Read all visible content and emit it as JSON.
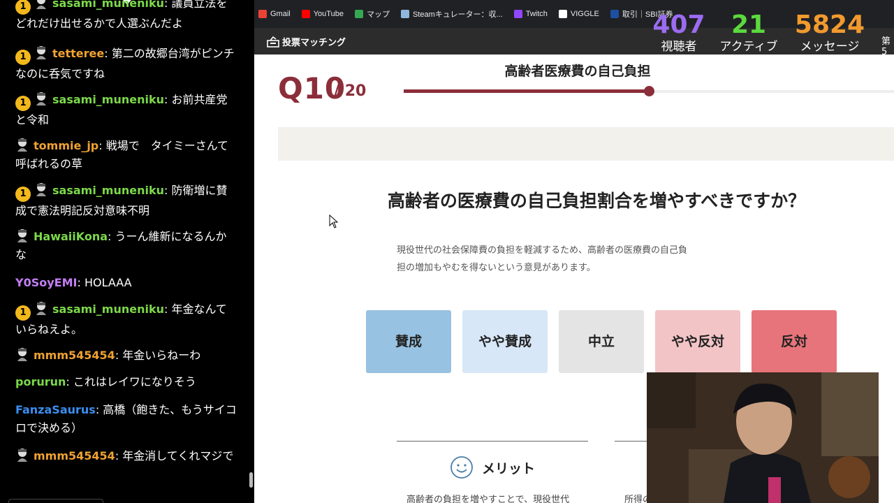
{
  "chat": {
    "messages": [
      {
        "badge": "1",
        "user": "sasami_muneniku",
        "color": "green",
        "text": ": 議員立法を どれだけ出せるかで人選ぶんだよ"
      },
      {
        "badge": "1",
        "user": "tetteree",
        "color": "orange",
        "text": ": 第二の故郷台湾がピンチなのに呑気ですね"
      },
      {
        "badge": "1",
        "user": "sasami_muneniku",
        "color": "green",
        "text": ": お前共産党と令和"
      },
      {
        "badge": "",
        "user": "tommie_jp",
        "color": "orange",
        "text": ": 戦場で　タイミーさんて呼ばれるの草"
      },
      {
        "badge": "1",
        "user": "sasami_muneniku",
        "color": "green",
        "text": ": 防衛増に賛成で憲法明記反対意味不明"
      },
      {
        "badge": "",
        "user": "HawaiiKona",
        "color": "green",
        "text": ": うーん維新になるんかな"
      },
      {
        "badge": "",
        "user": "Y0SoyEMI",
        "color": "purple",
        "text": ": HOLAAA"
      },
      {
        "badge": "1",
        "user": "sasami_muneniku",
        "color": "green",
        "text": ": 年金なんていらねえよ。"
      },
      {
        "badge": "",
        "user": "mmm545454",
        "color": "orange",
        "text": ": 年金いらねーわ"
      },
      {
        "badge": "",
        "user": "porurun",
        "color": "green",
        "text": ": これはレイワになりそう"
      },
      {
        "badge": "",
        "user": "FanzaSaurus",
        "color": "blue",
        "text": ": 高橋（飽きた、もうサイコロで決める）"
      },
      {
        "badge": "",
        "user": "mmm545454",
        "color": "orange",
        "text": ": 年金消してくれマジで"
      }
    ]
  },
  "bookmarks": [
    {
      "label": "Gmail",
      "icon": "gmail-icon",
      "color": "#ea4335"
    },
    {
      "label": "YouTube",
      "icon": "youtube-icon",
      "color": "#ff0000"
    },
    {
      "label": "マップ",
      "icon": "maps-icon",
      "color": "#34a853"
    },
    {
      "label": "Steamキュレーター：収...",
      "icon": "steam-icon",
      "color": "#8fb8de"
    },
    {
      "label": "Twitch",
      "icon": "twitch-icon",
      "color": "#9146ff"
    },
    {
      "label": "VIGGLE",
      "icon": "viggle-icon",
      "color": "#ffffff"
    },
    {
      "label": "取引｜SBI証券",
      "icon": "sbi-icon",
      "color": "#1d4fa3"
    }
  ],
  "site": {
    "logo_text": "投票マッチング"
  },
  "stats": {
    "viewers": {
      "value": "407",
      "label": "視聴者"
    },
    "active": {
      "value": "21",
      "label": "アクティブ"
    },
    "messages": {
      "value": "5824",
      "label": "メッセージ"
    },
    "extra": "第5"
  },
  "quiz": {
    "question_number": "Q10",
    "total": "/ 20",
    "progress": 0.5,
    "topic": "高齢者医療費の自己負担",
    "question": "高齢者の医療費の自己負担割合を増やすべきですか？",
    "description": "現役世代の社会保障費の負担を軽減するため、高齢者の医療費の自己負担の増加もやむを得ないという意見があります。",
    "choices": {
      "agree": "賛成",
      "somewhat_agree": "やや賛成",
      "neutral": "中立",
      "somewhat_disagree": "やや反対",
      "disagree": "反対"
    },
    "merit_heading": "メリット",
    "merit_text": "高齢者の負担を増やすことで、現役世代",
    "demerit_text": "所得の"
  }
}
